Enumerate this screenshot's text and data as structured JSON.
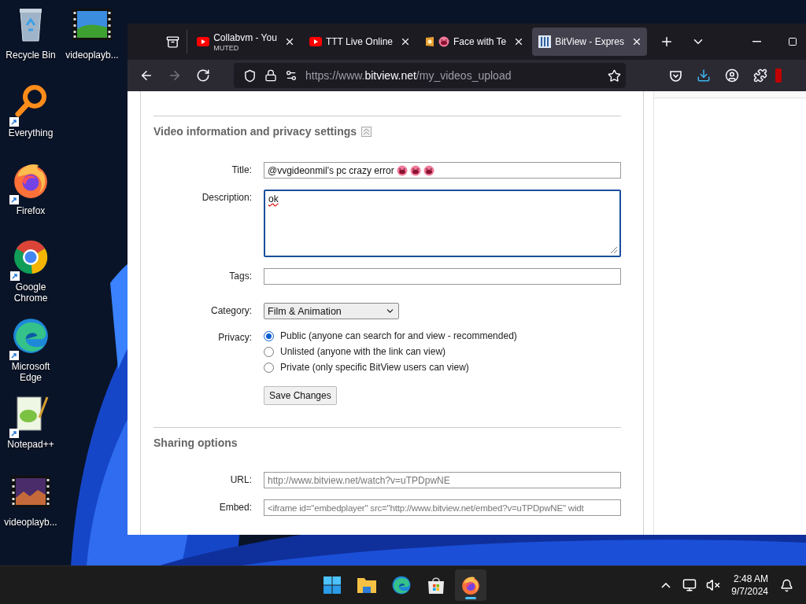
{
  "desktop": {
    "icons": [
      {
        "label": "Recycle Bin",
        "kind": "recyclebin",
        "shortcut": false
      },
      {
        "label": "Everything",
        "kind": "everything",
        "shortcut": true
      },
      {
        "label": "Firefox",
        "kind": "firefox",
        "shortcut": true
      },
      {
        "label": "Google Chrome",
        "kind": "chrome",
        "shortcut": true
      },
      {
        "label": "Microsoft Edge",
        "kind": "edge",
        "shortcut": true
      },
      {
        "label": "Notepad++",
        "kind": "notepad",
        "shortcut": true
      },
      {
        "label": "videoplayb...",
        "kind": "nightclip",
        "shortcut": false
      },
      {
        "label": "videoplayb...",
        "kind": "dayclip",
        "shortcut": false
      }
    ]
  },
  "browser": {
    "tabs": [
      {
        "title": "Collabvm - You",
        "subtitle": "MUTED",
        "kind": "youtube",
        "selected": false
      },
      {
        "title": "TTT Live Online",
        "kind": "youtube",
        "selected": false
      },
      {
        "title": "Face with Te",
        "kind": "emoji",
        "selected": false
      },
      {
        "title": "BitView - Expres",
        "kind": "bitview",
        "selected": true
      }
    ],
    "nav": [
      {
        "kind": "back",
        "disabled": false
      },
      {
        "kind": "forward",
        "disabled": true
      },
      {
        "kind": "reload",
        "disabled": false
      }
    ],
    "url": {
      "prefix": "https://www.",
      "domain": "bitview.net",
      "path": "/my_videos_upload"
    }
  },
  "page": {
    "section_title": "Video information and privacy settings",
    "form": [
      {
        "kind": "text",
        "label": "Title:",
        "value": "@vvgideonmil’s pc crazy error"
      },
      {
        "kind": "textarea",
        "label": "Description:",
        "value": "ok",
        "focused": true,
        "misspelled": true
      },
      {
        "kind": "text",
        "label": "Tags:"
      },
      {
        "kind": "select",
        "label": "Category:",
        "value": "Film & Animation"
      },
      {
        "kind": "radios",
        "label": "Privacy:",
        "options": [
          {
            "label": "Public (anyone can search for and view - recommended)",
            "selected": true
          },
          {
            "label": "Unlisted (anyone with the link can view)",
            "selected": false
          },
          {
            "label": "Private (only specific BitView users can view)",
            "selected": false
          }
        ]
      },
      {
        "kind": "button",
        "label": "Save Changes"
      }
    ],
    "sharing_title": "Sharing options",
    "sharing": [
      {
        "label": "URL:",
        "value": "http://www.bitview.net/watch?v=uTPDpwNE"
      },
      {
        "label": "Embed:",
        "value": "<iframe id=\"embedplayer\" src=\"http://www.bitview.net/embed?v=uTPDpwNE\" widt"
      }
    ]
  },
  "taskbar": {
    "apps": [
      {
        "kind": "start",
        "selected": false
      },
      {
        "kind": "explorer",
        "selected": false
      },
      {
        "kind": "edge",
        "selected": false
      },
      {
        "kind": "store",
        "selected": false
      },
      {
        "kind": "firefox",
        "selected": true
      }
    ],
    "time": "2:48 AM",
    "date": "9/7/2024"
  }
}
